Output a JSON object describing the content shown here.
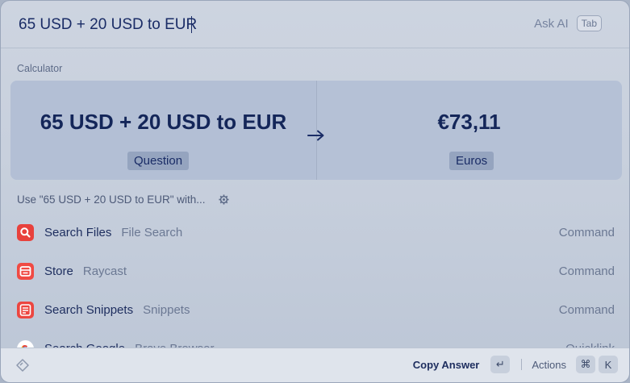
{
  "search": {
    "value": "65 USD + 20 USD to EUR",
    "ask_ai_label": "Ask AI",
    "ask_ai_key": "Tab"
  },
  "calculator": {
    "section_label": "Calculator",
    "question_value": "65 USD + 20 USD to EUR",
    "question_tag": "Question",
    "result_value": "€73,11",
    "result_tag": "Euros"
  },
  "use_with": {
    "label": "Use \"65 USD + 20 USD to EUR\" with..."
  },
  "results": [
    {
      "title": "Search Files",
      "subtitle": "File Search",
      "type": "Command",
      "icon": "search-files-icon",
      "color": "#e8413c"
    },
    {
      "title": "Store",
      "subtitle": "Raycast",
      "type": "Command",
      "icon": "store-icon",
      "color": "#f04a43"
    },
    {
      "title": "Search Snippets",
      "subtitle": "Snippets",
      "type": "Command",
      "icon": "snippets-icon",
      "color": "#ec4640"
    },
    {
      "title": "Search Google",
      "subtitle": "Brave Browser",
      "type": "Quicklink",
      "icon": "google-icon",
      "color": "#ffffff"
    }
  ],
  "footer": {
    "copy_label": "Copy Answer",
    "copy_key": "↵",
    "actions_label": "Actions",
    "actions_key_1": "⌘",
    "actions_key_2": "K"
  }
}
